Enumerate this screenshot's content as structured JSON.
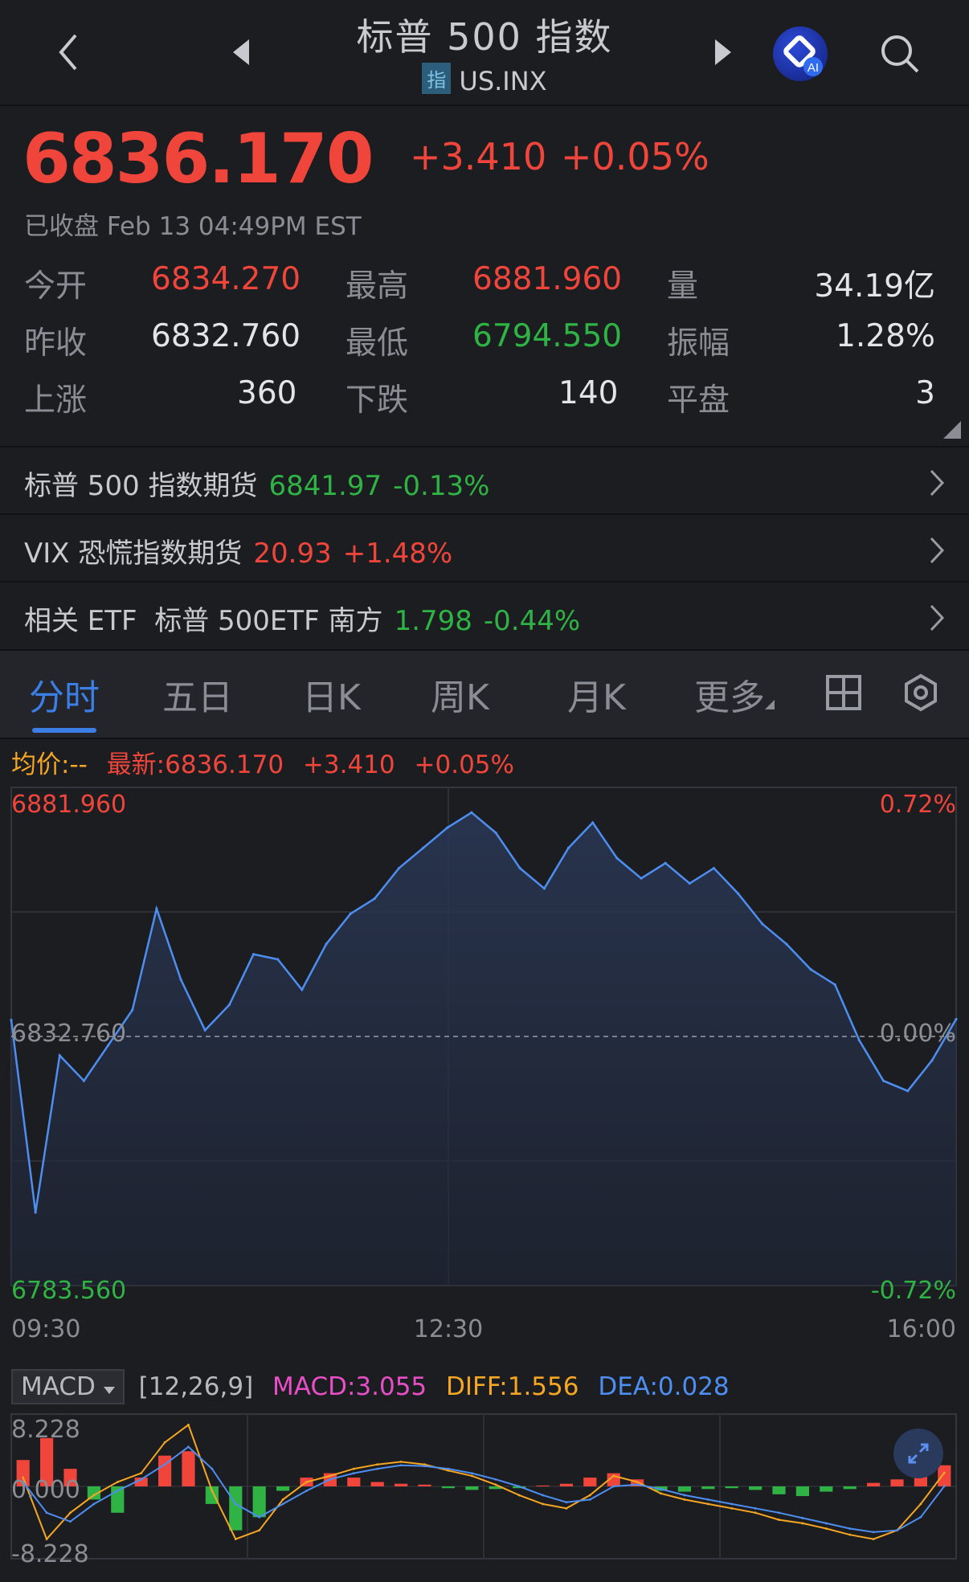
{
  "header": {
    "title": "标普 500 指数",
    "tag": "指",
    "symbol": "US.INX",
    "ai_badge": "AI"
  },
  "quote": {
    "price": "6836.170",
    "change": "+3.410",
    "change_pct": "+0.05%",
    "status": "已收盘 Feb 13 04:49PM EST"
  },
  "stats": {
    "open_label": "今开",
    "open": "6834.270",
    "high_label": "最高",
    "high": "6881.960",
    "volume_label": "量",
    "volume": "34.19亿",
    "prev_close_label": "昨收",
    "prev_close": "6832.760",
    "low_label": "最低",
    "low": "6794.550",
    "amplitude_label": "振幅",
    "amplitude": "1.28%",
    "up_label": "上涨",
    "up": "360",
    "down_label": "下跌",
    "down": "140",
    "flat_label": "平盘",
    "flat": "3"
  },
  "related": [
    {
      "label": "标普 500 指数期货",
      "value": "6841.97",
      "change": "-0.13%"
    },
    {
      "label": "VIX 恐慌指数期货",
      "value": "20.93",
      "change": "+1.48%"
    },
    {
      "label": "相关 ETF  标普 500ETF 南方",
      "value": "1.798",
      "change": "-0.44%"
    }
  ],
  "tabs": [
    "分时",
    "五日",
    "日K",
    "周K",
    "月K",
    "更多"
  ],
  "legend": {
    "avg": "均价:--",
    "latest": "最新:6836.170",
    "change": "+3.410",
    "pct": "+0.05%"
  },
  "colors": {
    "up": "#f0453b",
    "down": "#2fb344",
    "line": "#4d8ef0",
    "accent": "#3b7fe6",
    "macd": "#e84fc7",
    "diff": "#f5a623",
    "dea": "#4d8ef0",
    "avg": "#f5a623"
  },
  "macd": {
    "selector": "MACD",
    "params": "[12,26,9]",
    "macd": "MACD:3.055",
    "diff": "DIFF:1.556",
    "dea": "DEA:0.028"
  },
  "chart_data": [
    {
      "type": "line",
      "title": "",
      "y_left_top": "6881.960",
      "y_left_mid": "6832.760",
      "y_left_bottom": "6783.560",
      "y_right_top": "0.72%",
      "y_right_mid": "0.00%",
      "y_right_bottom": "-0.72%",
      "x_ticks": [
        "09:30",
        "12:30",
        "16:00"
      ],
      "ylim": [
        6783.56,
        6881.96
      ],
      "reference": 6832.76,
      "x": [
        "09:30",
        "09:40",
        "09:50",
        "10:00",
        "10:10",
        "10:20",
        "10:30",
        "10:40",
        "10:50",
        "11:00",
        "11:10",
        "11:20",
        "11:30",
        "11:40",
        "11:50",
        "12:00",
        "12:10",
        "12:20",
        "12:30",
        "12:40",
        "12:50",
        "13:00",
        "13:10",
        "13:20",
        "13:30",
        "13:40",
        "13:50",
        "14:00",
        "14:10",
        "14:20",
        "14:30",
        "14:40",
        "14:50",
        "15:00",
        "15:10",
        "15:20",
        "15:30",
        "15:40",
        "15:50",
        "16:00"
      ],
      "values": [
        6836.0,
        6798.0,
        6829.0,
        6824.0,
        6831.0,
        6838.0,
        6858.0,
        6844.0,
        6834.0,
        6839.0,
        6849.0,
        6848.0,
        6842.0,
        6851.0,
        6857.0,
        6860.0,
        6866.0,
        6870.0,
        6874.0,
        6877.0,
        6873.0,
        6866.0,
        6862.0,
        6870.0,
        6875.0,
        6868.0,
        6864.0,
        6867.0,
        6863.0,
        6866.0,
        6861.0,
        6855.0,
        6851.0,
        6846.0,
        6843.0,
        6832.0,
        6824.0,
        6822.0,
        6828.0,
        6836.17
      ]
    },
    {
      "type": "bar",
      "title": "MACD",
      "ylim": [
        -8.228,
        8.228
      ],
      "y_ticks": [
        "8.228",
        "0.000",
        "-8.228"
      ],
      "series": [
        {
          "name": "MACD",
          "values": [
            3.0,
            5.5,
            2.0,
            -1.5,
            -3.0,
            1.0,
            3.5,
            4.0,
            -2.0,
            -5.0,
            -3.5,
            -0.5,
            1.0,
            1.5,
            1.0,
            0.5,
            0.3,
            0.2,
            -0.2,
            -0.4,
            -0.3,
            -0.2,
            0.1,
            0.3,
            1.0,
            1.5,
            0.8,
            -0.5,
            -0.6,
            -0.3,
            -0.2,
            -0.4,
            -0.9,
            -1.1,
            -0.6,
            -0.3,
            0.4,
            0.8,
            1.6,
            2.4
          ]
        },
        {
          "name": "DIFF",
          "values": [
            1.0,
            -6.0,
            -3.0,
            -1.0,
            0.5,
            1.5,
            5.0,
            7.0,
            -0.5,
            -6.0,
            -5.0,
            -1.5,
            0.5,
            1.2,
            2.0,
            2.5,
            2.8,
            2.5,
            1.8,
            1.2,
            0.2,
            -1.0,
            -2.0,
            -2.5,
            -1.0,
            1.2,
            0.5,
            -0.8,
            -1.5,
            -2.0,
            -2.5,
            -3.0,
            -3.8,
            -4.2,
            -4.8,
            -5.5,
            -6.0,
            -5.0,
            -2.0,
            1.556
          ]
        },
        {
          "name": "DEA",
          "values": [
            0.5,
            -3.0,
            -4.0,
            -2.0,
            -0.5,
            0.8,
            2.5,
            4.5,
            2.0,
            -2.0,
            -3.5,
            -2.0,
            -0.5,
            0.8,
            1.5,
            2.0,
            2.4,
            2.3,
            2.0,
            1.5,
            0.8,
            0.0,
            -1.0,
            -1.8,
            -1.5,
            0.0,
            0.2,
            -0.3,
            -1.0,
            -1.5,
            -2.0,
            -2.5,
            -3.0,
            -3.6,
            -4.2,
            -4.8,
            -5.2,
            -5.0,
            -3.5,
            0.028
          ]
        }
      ]
    }
  ]
}
